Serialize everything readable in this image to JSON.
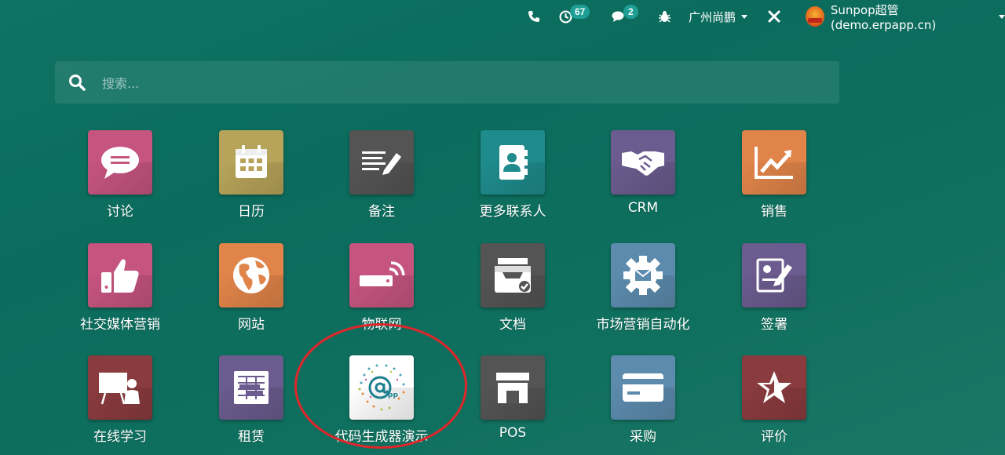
{
  "topbar": {
    "activity_count": "67",
    "messages_count": "2",
    "company": "广州尚鹏",
    "user": "Sunpop超管 (demo.erpapp.cn)"
  },
  "search": {
    "placeholder": "搜索..."
  },
  "apps": [
    {
      "label": "讨论",
      "icon": "chat-icon",
      "color": "#c5547f"
    },
    {
      "label": "日历",
      "icon": "calendar-icon",
      "color": "#b7a45a"
    },
    {
      "label": "备注",
      "icon": "note-icon",
      "color": "#545454"
    },
    {
      "label": "更多联系人",
      "icon": "contacts-book-icon",
      "color": "#1f8b8c"
    },
    {
      "label": "CRM",
      "icon": "handshake-icon",
      "color": "#6b5b8e"
    },
    {
      "label": "销售",
      "icon": "sales-chart-icon",
      "color": "#e08449"
    },
    {
      "label": "社交媒体营销",
      "icon": "thumbs-up-icon",
      "color": "#c5547f"
    },
    {
      "label": "网站",
      "icon": "globe-icon",
      "color": "#e08449"
    },
    {
      "label": "物联网",
      "icon": "iot-device-icon",
      "color": "#c5547f"
    },
    {
      "label": "文档",
      "icon": "inbox-tray-icon",
      "color": "#545454"
    },
    {
      "label": "市场营销自动化",
      "icon": "gear-envelope-icon",
      "color": "#5c8bad"
    },
    {
      "label": "签署",
      "icon": "sign-document-icon",
      "color": "#6b5b8e"
    },
    {
      "label": "在线学习",
      "icon": "presentation-icon",
      "color": "#8a3b3e"
    },
    {
      "label": "租赁",
      "icon": "rental-grid-icon",
      "color": "#6b5b8e"
    },
    {
      "label": "代码生成器演示",
      "icon": "app-logo-icon",
      "color": "#ffffff"
    },
    {
      "label": "POS",
      "icon": "store-icon",
      "color": "#545454"
    },
    {
      "label": "采购",
      "icon": "credit-card-icon",
      "color": "#5c8bad"
    },
    {
      "label": "评价",
      "icon": "star-icon",
      "color": "#8a3b3e"
    }
  ]
}
